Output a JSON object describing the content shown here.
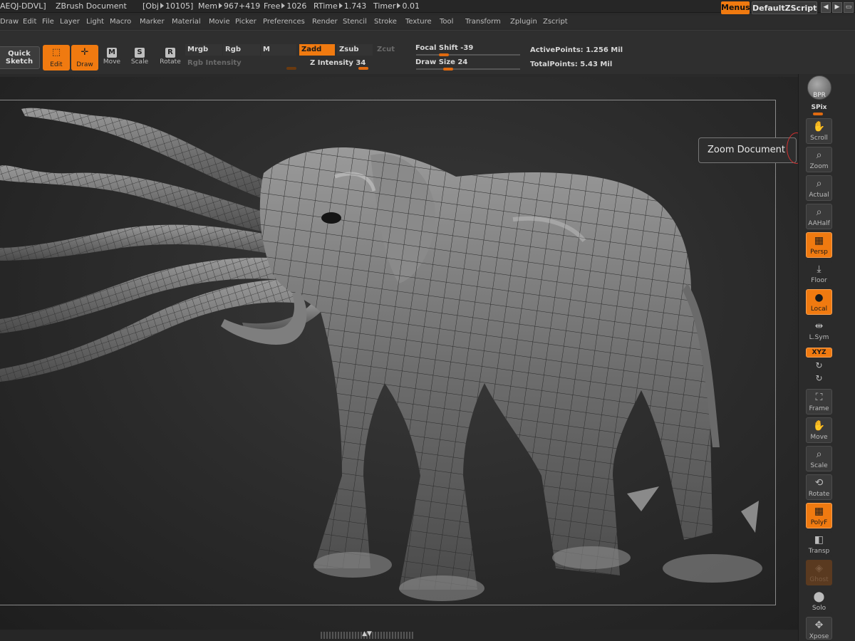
{
  "titlebar": {
    "app": "AEQJ-DDVL]",
    "document": "ZBrush Document",
    "obj_label": "[Obj",
    "obj_value": "10105]",
    "mem_label": "Mem",
    "mem_value": "967+419",
    "free_label": "Free",
    "free_value": "1026",
    "rtime_label": "RTime",
    "rtime_value": "1.743",
    "timer_label": "Timer",
    "timer_value": "0.01",
    "menus": "Menus",
    "zscript": "DefaultZScript"
  },
  "menubar": [
    "Draw",
    "Edit",
    "File",
    "Layer",
    "Light",
    "Macro",
    "Marker",
    "Material",
    "Movie",
    "Picker",
    "Preferences",
    "Render",
    "Stencil",
    "Stroke",
    "Texture",
    "Tool",
    "Transform",
    "Zplugin",
    "Zscript"
  ],
  "shelf": {
    "quick_sketch": [
      "Quick",
      "Sketch"
    ],
    "edit": "Edit",
    "draw": "Draw",
    "move": {
      "key": "M",
      "label": "Move"
    },
    "scale": {
      "key": "S",
      "label": "Scale"
    },
    "rotate": {
      "key": "R",
      "label": "Rotate"
    },
    "mrgb": "Mrgb",
    "rgb": "Rgb",
    "m": "M",
    "rgb_intensity": "Rgb Intensity",
    "zadd": "Zadd",
    "zsub": "Zsub",
    "zcut": "Zcut",
    "z_intensity_label": "Z Intensity",
    "z_intensity_value": "34",
    "focal_shift_label": "Focal Shift",
    "focal_shift_value": "-39",
    "draw_size_label": "Draw Size",
    "draw_size_value": "24",
    "active_points_label": "ActivePoints:",
    "active_points_value": "1.256 Mil",
    "total_points_label": "TotalPoints:",
    "total_points_value": "5.43 Mil"
  },
  "rdock": {
    "bpr": "BPR",
    "spix": "SPix",
    "scroll": "Scroll",
    "zoom": "Zoom",
    "actual": "Actual",
    "aahalf": "AAHalf",
    "persp": "Persp",
    "floor": "Floor",
    "local": "Local",
    "lsym": "L.Sym",
    "xyz": "XYZ",
    "frame": "Frame",
    "move": "Move",
    "scale": "Scale",
    "rotate": "Rotate",
    "polyf": "PolyF",
    "transp": "Transp",
    "ghost": "Ghost",
    "solo": "Solo",
    "xpose": "Xpose"
  },
  "tooltip": "Zoom Document",
  "colors": {
    "accent": "#f07a10",
    "canvas": "#2a2a2a",
    "panel": "#2f2f2f"
  }
}
